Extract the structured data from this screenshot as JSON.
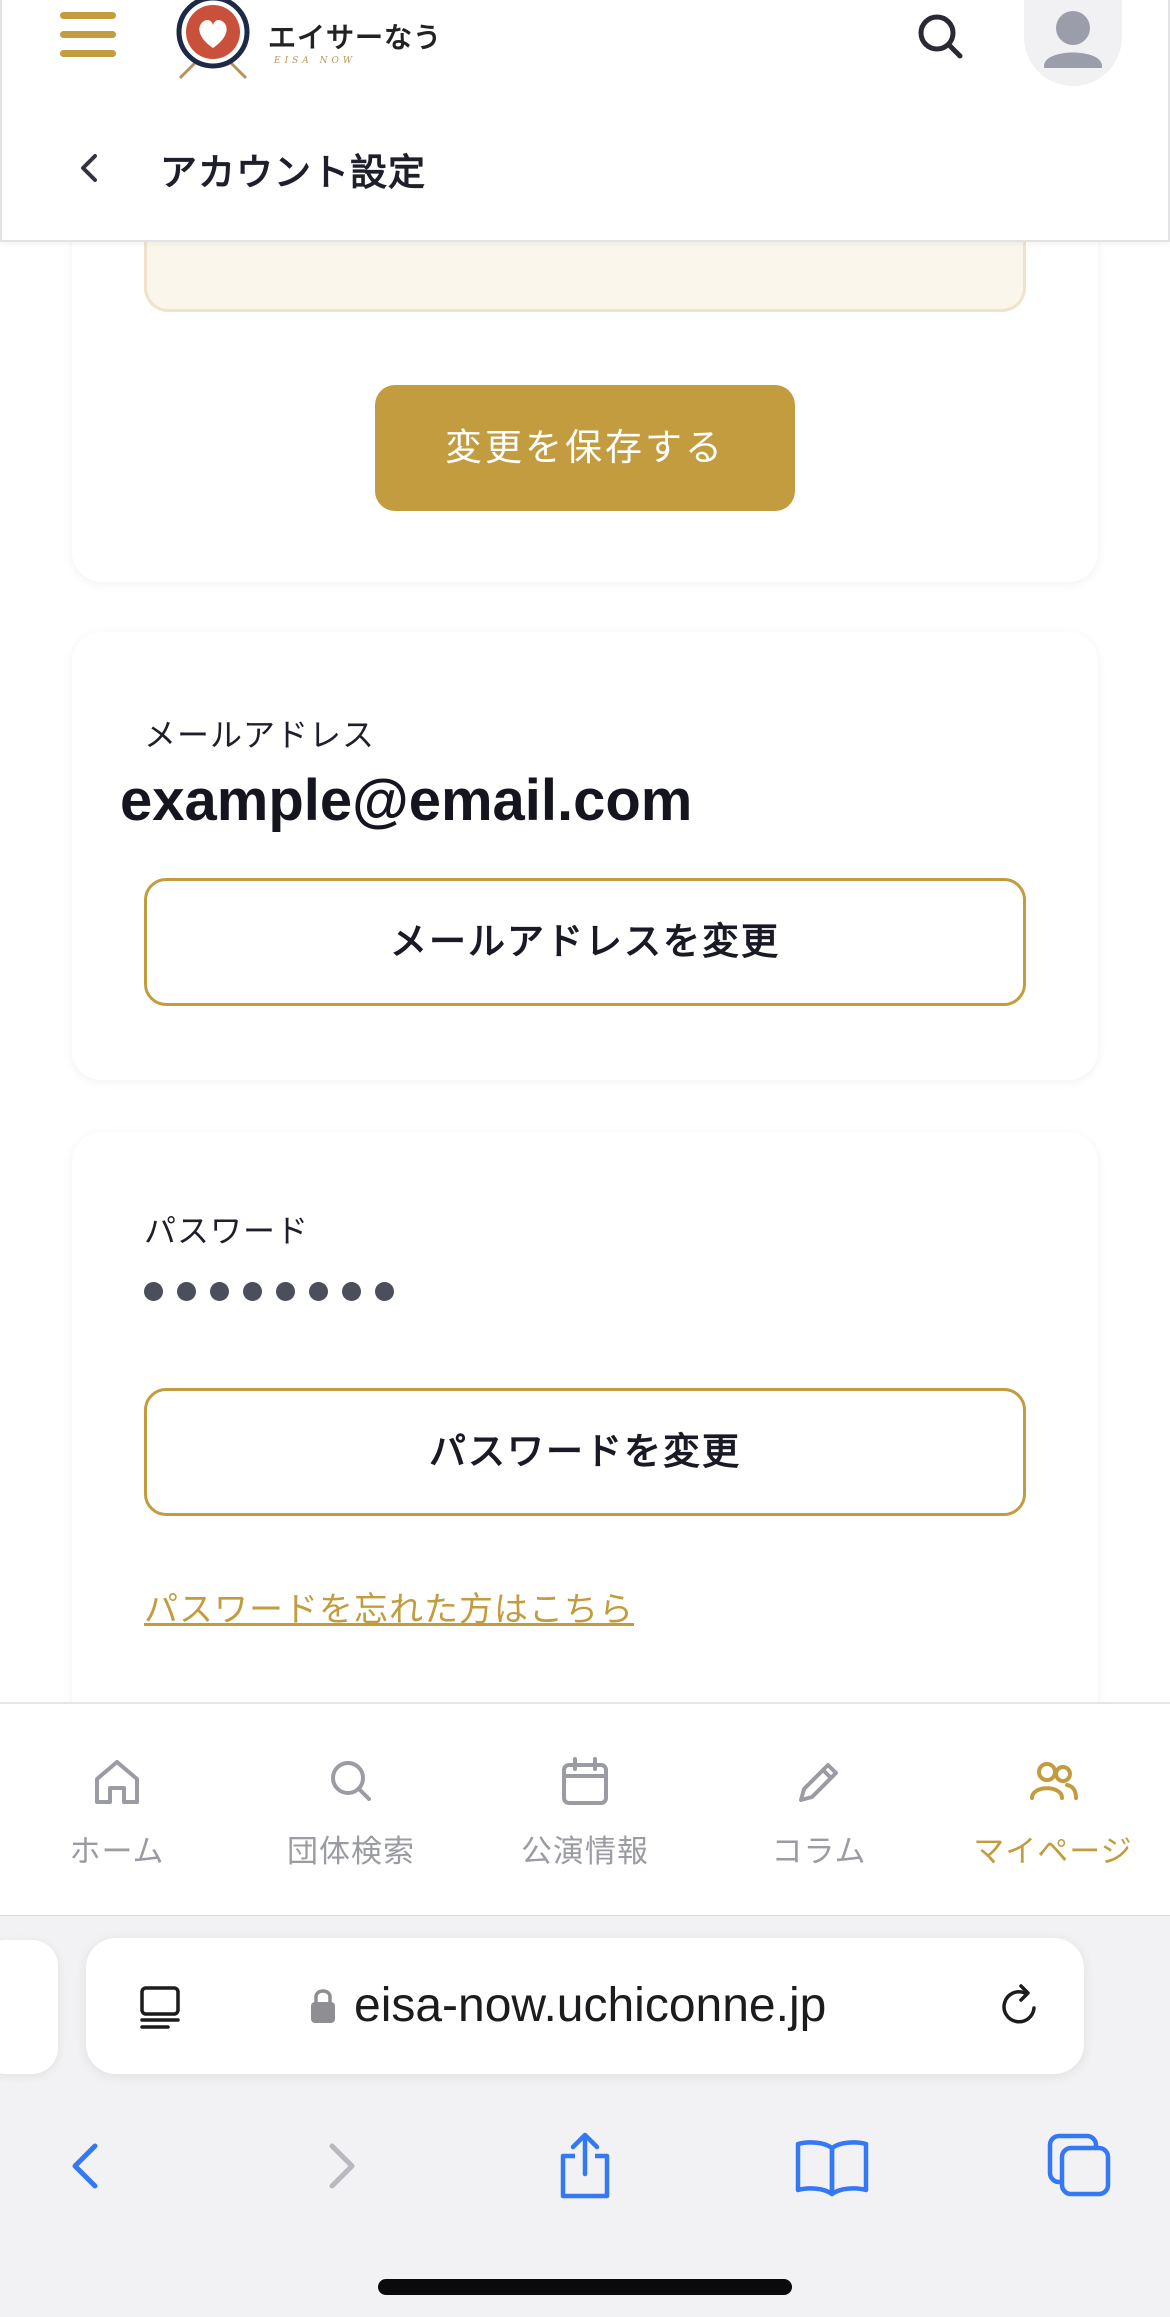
{
  "header": {
    "logo_text": "エイサーなう",
    "logo_subtext": "EISA NOW",
    "page_title": "アカウント設定"
  },
  "profile_card": {
    "save_label": "変更を保存する"
  },
  "email_card": {
    "label": "メールアドレス",
    "value": "example@email.com",
    "change_label": "メールアドレスを変更"
  },
  "password_card": {
    "label": "パスワード",
    "masked_length": 8,
    "change_label": "パスワードを変更",
    "forgot_label": "パスワードを忘れた方はこちら"
  },
  "tabbar": {
    "items": [
      {
        "label": "ホーム",
        "icon": "home-icon",
        "active": false
      },
      {
        "label": "団体検索",
        "icon": "search-icon",
        "active": false
      },
      {
        "label": "公演情報",
        "icon": "calendar-icon",
        "active": false
      },
      {
        "label": "コラム",
        "icon": "pencil-icon",
        "active": false
      },
      {
        "label": "マイページ",
        "icon": "users-icon",
        "active": true
      }
    ]
  },
  "browser": {
    "url": "eisa-now.uchiconne.jp"
  },
  "colors": {
    "accent": "#c29c3e",
    "text": "#1f1f2b",
    "tab_inactive": "#9a9ba3",
    "ios_blue": "#3478f6"
  }
}
